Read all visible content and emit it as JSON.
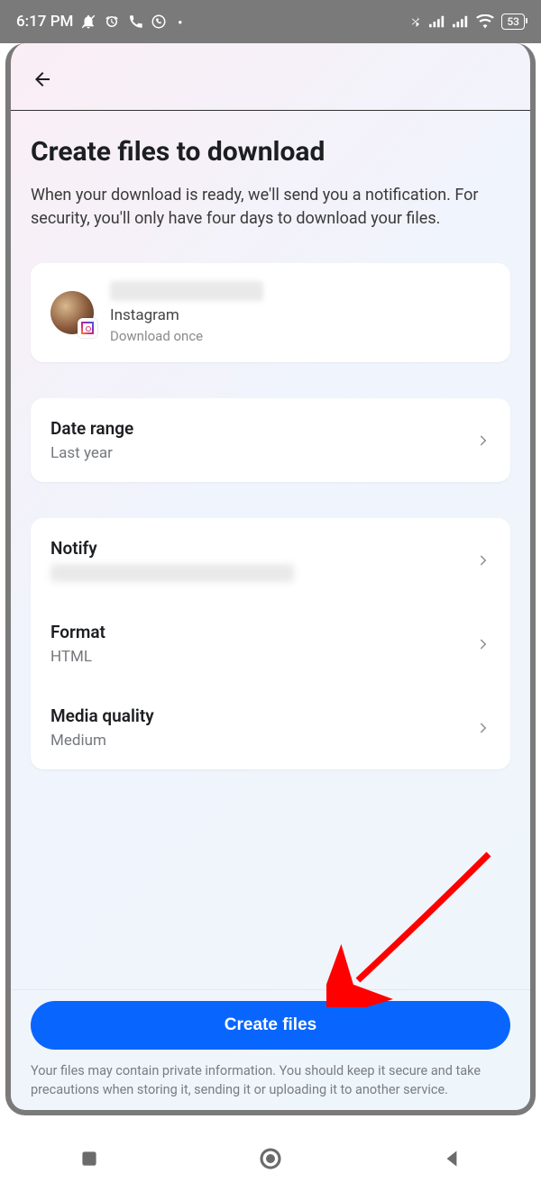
{
  "status": {
    "time": "6:17 PM",
    "battery": "53"
  },
  "page": {
    "title": "Create files to download",
    "subtitle": "When your download is ready, we'll send you a notification. For security, you'll only have four days to download your files."
  },
  "account": {
    "platform": "Instagram",
    "frequency": "Download once"
  },
  "settings": {
    "date_range": {
      "label": "Date range",
      "value": "Last year"
    },
    "notify": {
      "label": "Notify",
      "value": ""
    },
    "format": {
      "label": "Format",
      "value": "HTML"
    },
    "media_quality": {
      "label": "Media quality",
      "value": "Medium"
    }
  },
  "cta": {
    "button": "Create files",
    "disclaimer": "Your files may contain private information. You should keep it secure and take precautions when storing it, sending it or uploading it to another service."
  }
}
